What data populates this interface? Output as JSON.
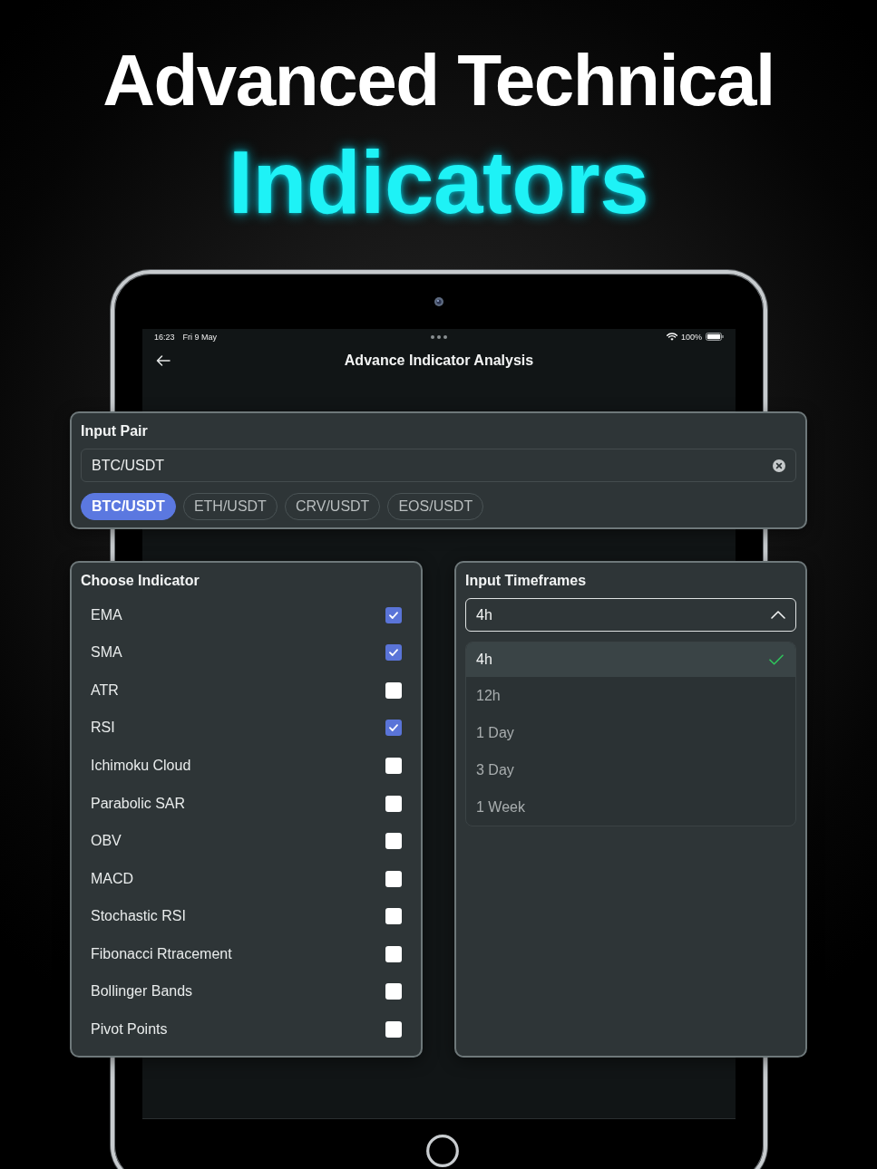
{
  "headline": {
    "line_1": "Advanced Technical",
    "line_2": "Indicators"
  },
  "device": {
    "status_bar": {
      "time": "16:23",
      "date": "Fri 9 May",
      "battery": "100%"
    },
    "nav_bar": {
      "title": "Advance Indicator Analysis"
    }
  },
  "input_pair": {
    "title": "Input Pair",
    "field": {
      "value": "BTC/USDT"
    },
    "chips": [
      {
        "label": "BTC/USDT",
        "selected": true
      },
      {
        "label": "ETH/USDT",
        "selected": false
      },
      {
        "label": "CRV/USDT",
        "selected": false
      },
      {
        "label": "EOS/USDT",
        "selected": false
      }
    ]
  },
  "indicators": {
    "title": "Choose Indicator",
    "items": [
      {
        "label": "EMA",
        "checked": true
      },
      {
        "label": "SMA",
        "checked": true
      },
      {
        "label": "ATR",
        "checked": false
      },
      {
        "label": "RSI",
        "checked": true
      },
      {
        "label": "Ichimoku Cloud",
        "checked": false
      },
      {
        "label": "Parabolic SAR",
        "checked": false
      },
      {
        "label": "OBV",
        "checked": false
      },
      {
        "label": "MACD",
        "checked": false
      },
      {
        "label": "Stochastic RSI",
        "checked": false
      },
      {
        "label": "Fibonacci Rtracement",
        "checked": false
      },
      {
        "label": "Bollinger Bands",
        "checked": false
      },
      {
        "label": "Pivot Points",
        "checked": false
      }
    ]
  },
  "timeframes": {
    "title": "Input Timeframes",
    "select": {
      "value": "4h",
      "expanded": true
    },
    "options": [
      {
        "label": "4h",
        "selected": true
      },
      {
        "label": "12h",
        "selected": false
      },
      {
        "label": "1 Day",
        "selected": false
      },
      {
        "label": "3 Day",
        "selected": false
      },
      {
        "label": "1 Week",
        "selected": false
      }
    ]
  }
}
